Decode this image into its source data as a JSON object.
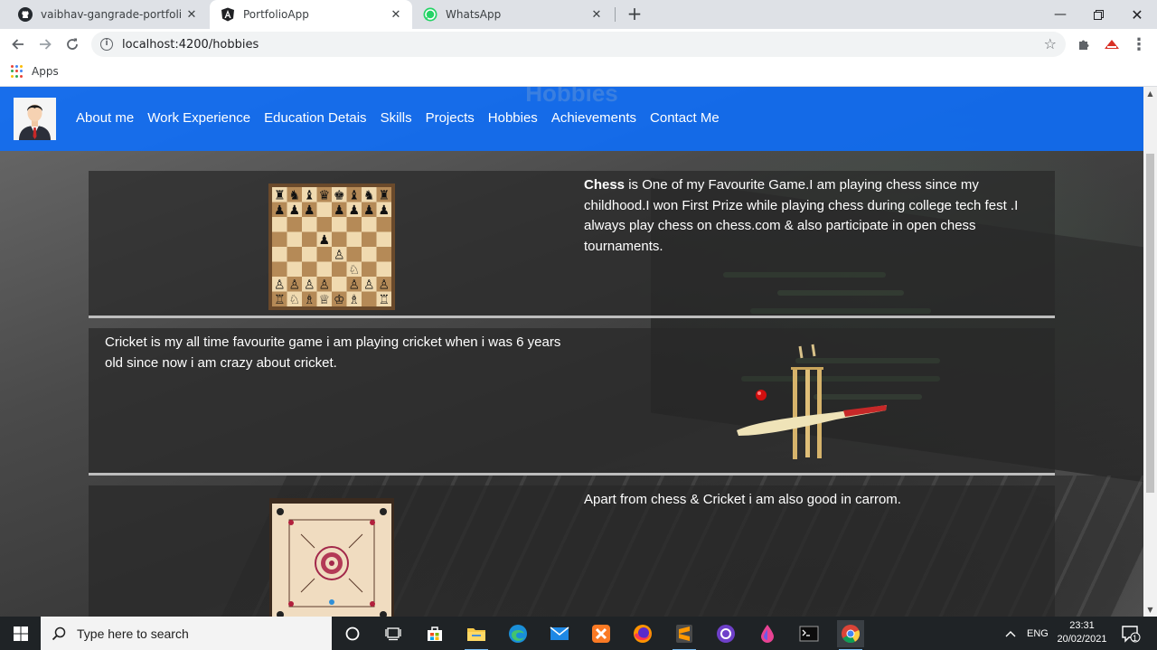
{
  "browser": {
    "tabs": [
      {
        "title": "vaibhav-gangrade-portfoli-with-",
        "icon": "github-icon"
      },
      {
        "title": "PortfolioApp",
        "icon": "angular-icon"
      },
      {
        "title": "WhatsApp",
        "icon": "whatsapp-icon"
      }
    ],
    "url": "localhost:4200/hobbies",
    "bookmarks": {
      "apps_label": "Apps"
    }
  },
  "page": {
    "heading": "Hobbies",
    "nav": [
      "About me",
      "Work Experience",
      "Education Detais",
      "Skills",
      "Projects",
      "Hobbies",
      "Achievements",
      "Contact Me"
    ],
    "hobbies": [
      {
        "bold": "Chess",
        "text": " is One of my Favourite Game.I am playing chess since my childhood.I won First Prize while playing chess during college tech fest .I always play chess on chess.com & also participate in open chess tournaments.",
        "image": "chess-board-image"
      },
      {
        "bold": "",
        "text": "Cricket is my all time favourite game i am playing cricket when i was 6 years old since now i am crazy about cricket.",
        "image": "cricket-image"
      },
      {
        "bold": "",
        "text": "Apart from chess & Cricket i am also good in carrom.",
        "image": "carrom-board-image"
      }
    ]
  },
  "taskbar": {
    "search_placeholder": "Type here to search",
    "language": "ENG",
    "time": "23:31",
    "date": "20/02/2021",
    "notification_count": "1"
  },
  "colors": {
    "navbar": "#0d6efd",
    "heading": "#3a7fe0",
    "taskbar": "#1f2326"
  }
}
